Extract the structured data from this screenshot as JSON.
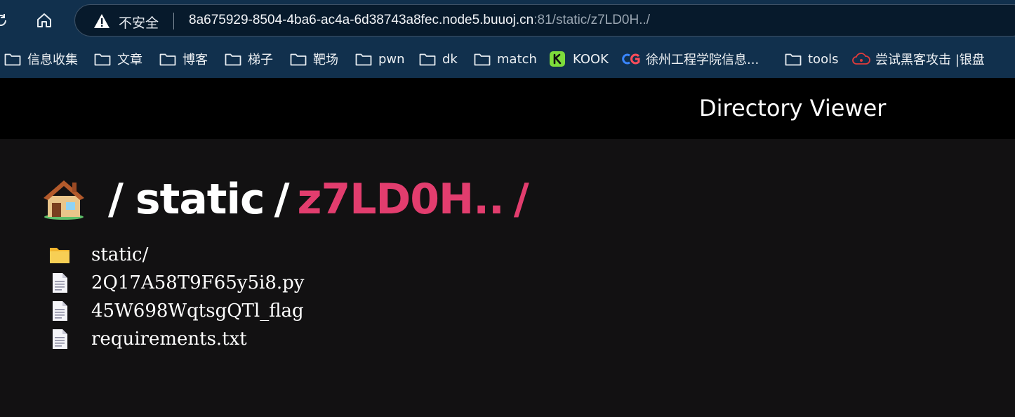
{
  "browser": {
    "security_label": "不安全",
    "url_host": "8a675929-8504-4ba6-ac4a-6d38743a8fec.node5.buuoj.cn",
    "url_rest": ":81/static/z7LD0H../",
    "bookmarks": [
      {
        "label": "信息收集",
        "icon": "folder-icon"
      },
      {
        "label": "文章",
        "icon": "folder-icon"
      },
      {
        "label": "博客",
        "icon": "folder-icon"
      },
      {
        "label": "梯子",
        "icon": "folder-icon"
      },
      {
        "label": "靶场",
        "icon": "folder-icon"
      },
      {
        "label": "pwn",
        "icon": "folder-icon"
      },
      {
        "label": "dk",
        "icon": "folder-icon"
      },
      {
        "label": "match",
        "icon": "folder-icon"
      },
      {
        "label": "KOOK",
        "icon": "kook-icon"
      },
      {
        "label": "徐州工程学院信息...",
        "icon": "cg-icon"
      },
      {
        "label": "tools",
        "icon": "folder-icon"
      },
      {
        "label": "尝试黑客攻击 |银盘",
        "icon": "cloud-icon"
      }
    ]
  },
  "page": {
    "title": "Directory Viewer",
    "breadcrumb": {
      "home_icon": "house-icon",
      "sep1": "/",
      "static": "static",
      "sep2": "/",
      "current": "z7LD0H..",
      "sep3": "/"
    },
    "entries": [
      {
        "name": "static/",
        "type": "folder",
        "icon": "folder-icon"
      },
      {
        "name": "2Q17A58T9F65y5i8.py",
        "type": "file",
        "icon": "file-icon"
      },
      {
        "name": "45W698WqtsgQTl_flag",
        "type": "file",
        "icon": "file-icon"
      },
      {
        "name": "requirements.txt",
        "type": "file",
        "icon": "file-icon"
      }
    ]
  }
}
